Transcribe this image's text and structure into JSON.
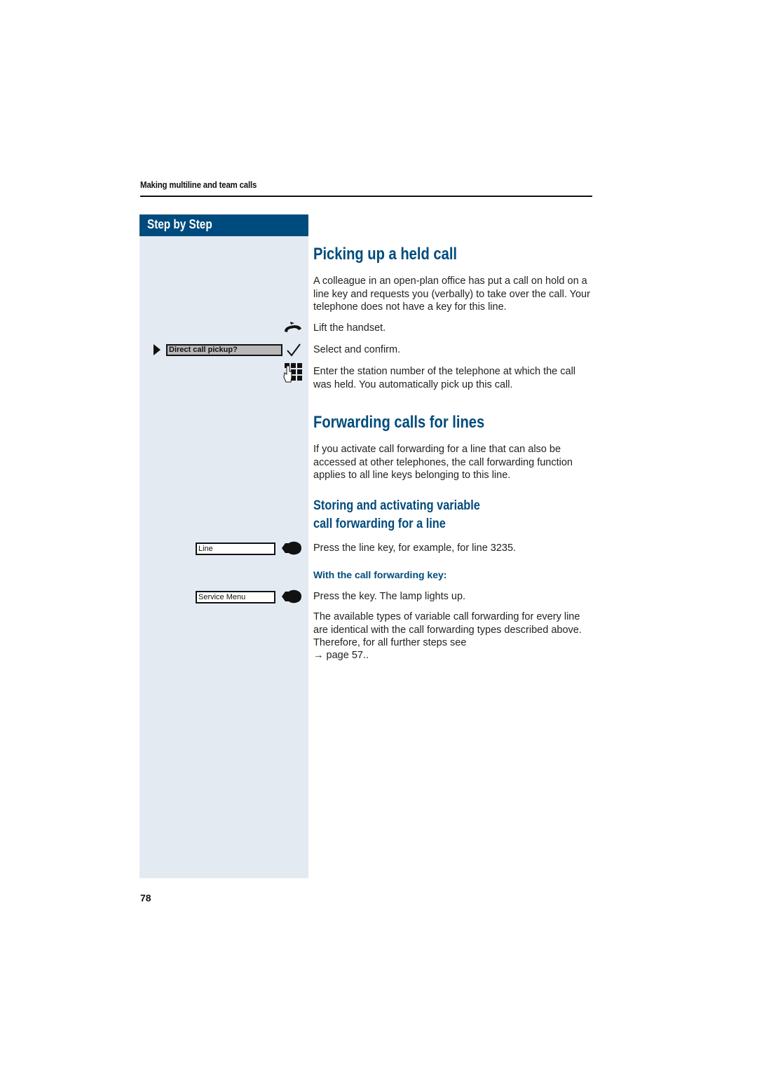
{
  "running_head": "Making multiline and team calls",
  "sidebar": {
    "title": "Step by Step",
    "display_prompt": "Direct call pickup?",
    "keys": [
      {
        "label": "Line"
      },
      {
        "label": "Service Menu"
      }
    ]
  },
  "section1": {
    "title": "Picking up a held call",
    "intro": "A colleague in an open-plan office has put a call on hold on a line key and requests you (verbally) to take over the call. Your telephone does not have a key for this line.",
    "steps": [
      {
        "icon": "handset-lift-icon",
        "text": "Lift the handset."
      },
      {
        "icon": "checkmark-icon",
        "text": "Select and confirm."
      },
      {
        "icon": "keypad-icon",
        "text": "Enter the station number of the telephone at which the call was held. You automatically pick up this call."
      }
    ]
  },
  "section2": {
    "title": "Forwarding calls for lines",
    "intro": "If you activate call forwarding for a line that can also be accessed at other telephones, the call forwarding function applies to all line keys belonging to this line.",
    "subtitle_line1": "Storing and activating variable",
    "subtitle_line2": "call forwarding for a line",
    "step_line_key": "Press the line key, for example, for line 3235.",
    "subheading": "With the call forwarding key:",
    "step_press_key": "Press the key. The lamp lights up.",
    "closing": "The available types of variable call forwarding for every line are identical with the call forwarding types described above. Therefore, for all further steps see",
    "page_ref": "→ page 57.."
  },
  "page_number": "78"
}
